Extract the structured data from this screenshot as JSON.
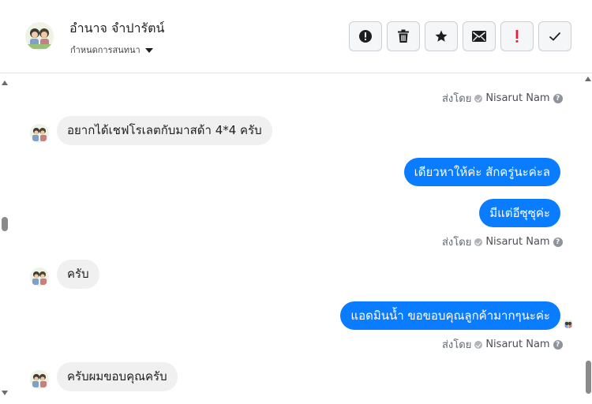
{
  "header": {
    "contact_name": "อำนาจ จำปารัตน์",
    "subtitle": "กำหนดการสนทนา"
  },
  "actions": [
    {
      "icon": "alert-icon",
      "name": "mark-spam-button"
    },
    {
      "icon": "trash-icon",
      "name": "delete-button"
    },
    {
      "icon": "star-icon",
      "name": "star-button"
    },
    {
      "icon": "envelope-icon",
      "name": "mark-unread-button"
    },
    {
      "icon": "exclamation-icon",
      "name": "mark-important-button"
    },
    {
      "icon": "check-icon",
      "name": "mark-done-button"
    }
  ],
  "messages": {
    "m1_sent_prefix": "ส่งโดย",
    "m1_sender": "Nisarut Nam",
    "m2_text": "อยากได้เชฟโรเลตกับมาสด้า 4*4 ครับ",
    "m3_text": "เดียวหาให้ค่ะ สักครู่นะค่ะล",
    "m4_text": "มีแต่อีซุซุค่ะ",
    "m4_sent_prefix": "ส่งโดย",
    "m4_sender": "Nisarut Nam",
    "m5_text": "ครับ",
    "m6_text": "แอดมินน้ำ ขอขอบคุณลูกค้ามากๆนะค่ะ",
    "m6_sent_prefix": "ส่งโดย",
    "m6_sender": "Nisarut Nam",
    "m7_text": "ครับผมขอบคุณครับ"
  },
  "colors": {
    "outgoing_bubble": "#0a7cff",
    "incoming_bubble": "#f0f0f0",
    "important_red": "#e41e3f"
  }
}
